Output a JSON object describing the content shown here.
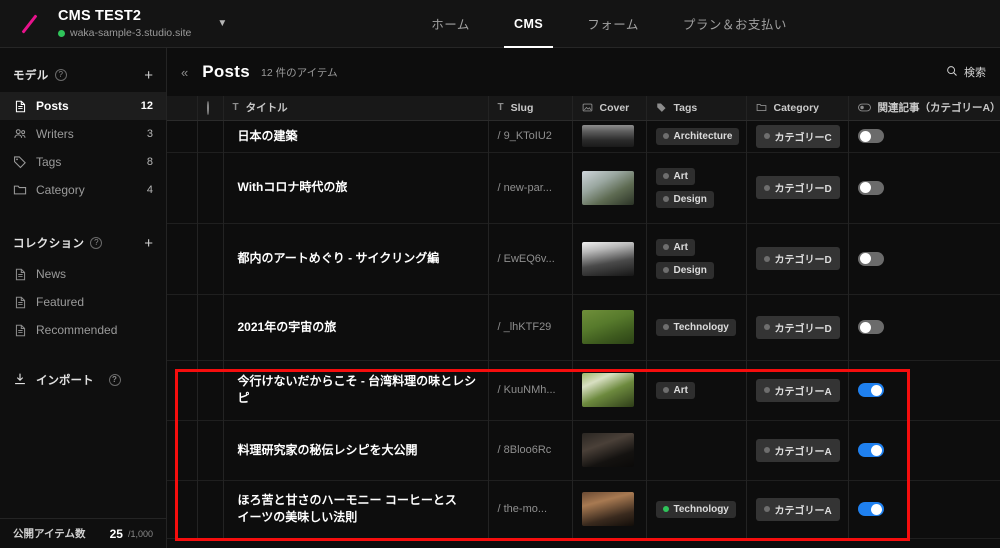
{
  "topbar": {
    "logo_icon": "slash-logo-icon",
    "site_title": "CMS TEST2",
    "site_url": "waka-sample-3.studio.site",
    "caret_icon": "chevron-down-icon",
    "tabs": [
      {
        "label": "ホーム",
        "active": false
      },
      {
        "label": "CMS",
        "active": true
      },
      {
        "label": "フォーム",
        "active": false
      },
      {
        "label": "プラン＆お支払い",
        "active": false
      }
    ]
  },
  "sidebar": {
    "models_section": {
      "title": "モデル",
      "help_icon": "question-mark-icon",
      "add_icon": "plus-icon"
    },
    "models": [
      {
        "label": "Posts",
        "count": "12",
        "icon": "document-icon",
        "active": true
      },
      {
        "label": "Writers",
        "count": "3",
        "icon": "users-icon",
        "active": false
      },
      {
        "label": "Tags",
        "count": "8",
        "icon": "tag-icon",
        "active": false
      },
      {
        "label": "Category",
        "count": "4",
        "icon": "folder-icon",
        "active": false
      }
    ],
    "collections_section": {
      "title": "コレクション",
      "help_icon": "question-mark-icon",
      "add_icon": "plus-icon"
    },
    "collections": [
      {
        "label": "News",
        "icon": "document-icon"
      },
      {
        "label": "Featured",
        "icon": "document-icon"
      },
      {
        "label": "Recommended",
        "icon": "document-icon"
      }
    ],
    "import": {
      "label": "インポート",
      "icon": "download-icon",
      "help_icon": "question-mark-icon"
    },
    "footer": {
      "label": "公開アイテム数",
      "value": "25",
      "max": "/1,000"
    }
  },
  "main": {
    "collapse_icon": "double-chevron-left-icon",
    "title": "Posts",
    "count_text": "12 件のアイテム",
    "search": {
      "label": "検索",
      "icon": "search-icon"
    }
  },
  "table": {
    "columns": [
      {
        "key": "checkbox",
        "label": "",
        "icon": "checkbox-icon"
      },
      {
        "key": "status",
        "label": "",
        "icon": "circle-icon"
      },
      {
        "key": "title",
        "label": "タイトル",
        "icon": "text-type-icon"
      },
      {
        "key": "slug",
        "label": "Slug",
        "icon": "text-type-icon"
      },
      {
        "key": "cover",
        "label": "Cover",
        "icon": "image-icon"
      },
      {
        "key": "tags",
        "label": "Tags",
        "icon": "tag-icon"
      },
      {
        "key": "category",
        "label": "Category",
        "icon": "folder-icon"
      },
      {
        "key": "related",
        "label": "関連記事（カテゴリーA）",
        "icon": "toggle-icon"
      }
    ],
    "rows": [
      {
        "published": true,
        "title": "日本の建築",
        "slug": "/ 9_KToIU2",
        "cover_class": "th-a",
        "tags": [
          {
            "label": "Architecture",
            "dot": "grey"
          }
        ],
        "category": "カテゴリーC",
        "related_on": false,
        "highlighted": false,
        "clipped_top": true
      },
      {
        "published": true,
        "title": "Withコロナ時代の旅",
        "slug": "/ new-par...",
        "cover_class": "th-b",
        "tags": [
          {
            "label": "Art",
            "dot": "grey"
          },
          {
            "label": "Design",
            "dot": "grey"
          }
        ],
        "category": "カテゴリーD",
        "related_on": false,
        "highlighted": false
      },
      {
        "published": true,
        "title": "都内のアートめぐり - サイクリング編",
        "slug": "/ EwEQ6v...",
        "cover_class": "th-c",
        "tags": [
          {
            "label": "Art",
            "dot": "grey"
          },
          {
            "label": "Design",
            "dot": "grey"
          }
        ],
        "category": "カテゴリーD",
        "related_on": false,
        "highlighted": false
      },
      {
        "published": true,
        "title": "2021年の宇宙の旅",
        "slug": "/ _lhKTF29",
        "cover_class": "th-d",
        "tags": [
          {
            "label": "Technology",
            "dot": "grey"
          }
        ],
        "category": "カテゴリーD",
        "related_on": false,
        "highlighted": false
      },
      {
        "published": true,
        "title": "今行けないだからこそ - 台湾料理の味とレシピ",
        "slug": "/ KuuNMh...",
        "cover_class": "th-e",
        "tags": [
          {
            "label": "Art",
            "dot": "grey"
          }
        ],
        "category": "カテゴリーA",
        "related_on": true,
        "highlighted": true
      },
      {
        "published": true,
        "title": "料理研究家の秘伝レシピを大公開",
        "slug": "/ 8Bloo6Rc",
        "cover_class": "th-f",
        "tags": [],
        "category": "カテゴリーA",
        "related_on": true,
        "highlighted": true
      },
      {
        "published": true,
        "title": "ほろ苦と甘さのハーモニー コーヒーとスイーツの美味しい法則",
        "slug": "/ the-mo...",
        "cover_class": "th-g",
        "tags": [
          {
            "label": "Technology",
            "dot": "green"
          }
        ],
        "category": "カテゴリーA",
        "related_on": true,
        "highlighted": true
      }
    ]
  },
  "annotation": {
    "highlight_box_color": "#f50d0d"
  },
  "colors": {
    "accent_pink": "#e8128c",
    "published_green": "#2fc45a",
    "toggle_on_blue": "#1f80ef",
    "background": "#0d0d0d",
    "panel": "#141414"
  }
}
